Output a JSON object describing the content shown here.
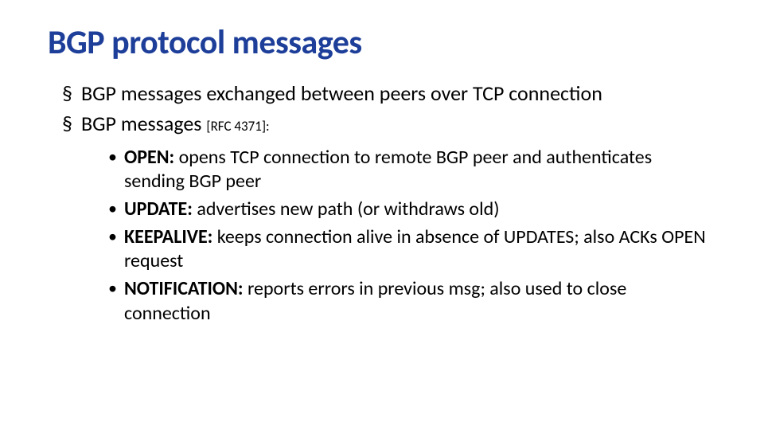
{
  "title": "BGP protocol messages",
  "bullets": {
    "item1": "BGP messages exchanged between peers over TCP connection",
    "item2_prefix": "BGP messages ",
    "item2_ref": "[RFC 4371]:"
  },
  "msgs": {
    "open": {
      "name": "OPEN:",
      "desc": " opens TCP connection to remote BGP peer and authenticates sending BGP peer"
    },
    "update": {
      "name": "UPDATE:",
      "desc": " advertises new path (or withdraws old)"
    },
    "keepalive": {
      "name": "KEEPALIVE:",
      "desc": " keeps connection alive in absence of UPDATES; also ACKs OPEN request"
    },
    "notification": {
      "name": "NOTIFICATION:",
      "desc": " reports errors in previous msg; also used to close connection"
    }
  }
}
